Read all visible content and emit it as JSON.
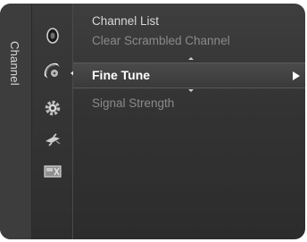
{
  "sidebar": {
    "title": "Channel"
  },
  "icons": [
    {
      "name": "picture-icon"
    },
    {
      "name": "channel-icon",
      "active": true
    },
    {
      "name": "setup-icon"
    },
    {
      "name": "input-icon"
    },
    {
      "name": "application-icon"
    }
  ],
  "menu": {
    "items": [
      {
        "label": "Channel List"
      },
      {
        "label": "Clear Scrambled Channel"
      },
      {
        "label": "Fine Tune"
      },
      {
        "label": "Signal Strength"
      }
    ]
  },
  "colors": {
    "panel_bg": "#333333",
    "text": "#d8d8d8",
    "text_dim": "#8a8a8a",
    "selected_text": "#ffffff"
  }
}
